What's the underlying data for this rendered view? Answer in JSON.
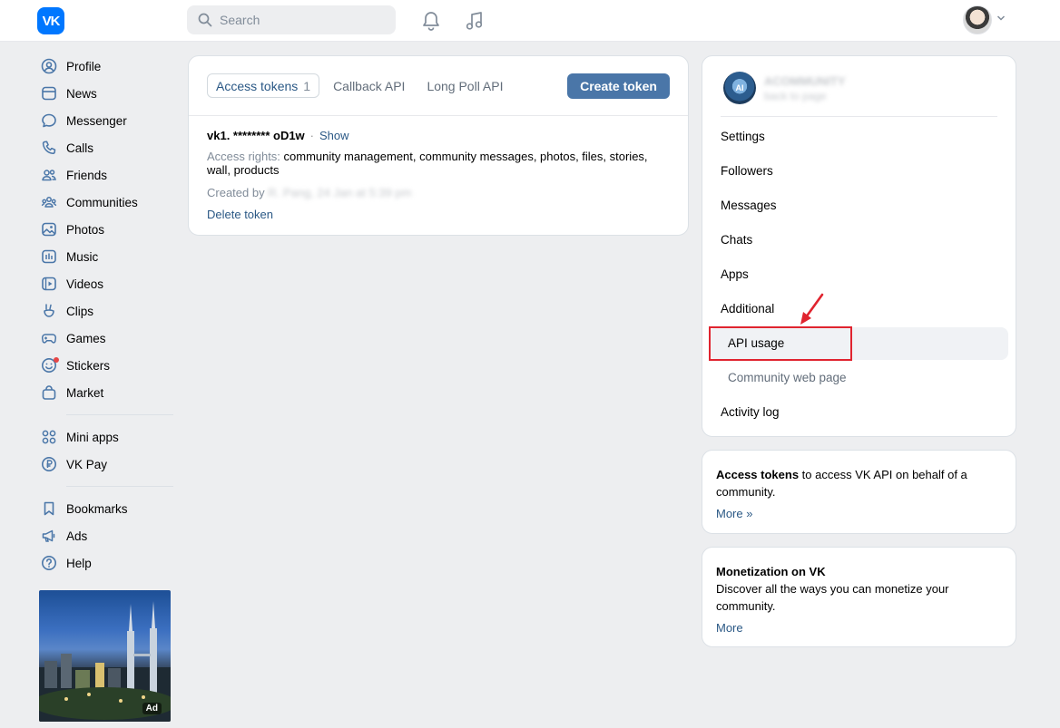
{
  "header": {
    "logo_text": "VK",
    "search_placeholder": "Search",
    "icons": [
      "bell-icon",
      "music-icon",
      "chevron-down-icon"
    ]
  },
  "nav": {
    "items": [
      {
        "label": "Profile",
        "icon": "profile-icon"
      },
      {
        "label": "News",
        "icon": "news-icon"
      },
      {
        "label": "Messenger",
        "icon": "messenger-icon"
      },
      {
        "label": "Calls",
        "icon": "phone-icon"
      },
      {
        "label": "Friends",
        "icon": "friends-icon"
      },
      {
        "label": "Communities",
        "icon": "communities-icon"
      },
      {
        "label": "Photos",
        "icon": "photos-icon"
      },
      {
        "label": "Music",
        "icon": "music-icon"
      },
      {
        "label": "Videos",
        "icon": "videos-icon"
      },
      {
        "label": "Clips",
        "icon": "clips-icon"
      },
      {
        "label": "Games",
        "icon": "games-icon"
      },
      {
        "label": "Stickers",
        "icon": "stickers-icon"
      },
      {
        "label": "Market",
        "icon": "market-icon"
      }
    ],
    "items2": [
      {
        "label": "Mini apps",
        "icon": "mini-apps-icon"
      },
      {
        "label": "VK Pay",
        "icon": "vk-pay-icon"
      }
    ],
    "items3": [
      {
        "label": "Bookmarks",
        "icon": "bookmark-icon"
      },
      {
        "label": "Ads",
        "icon": "megaphone-icon"
      },
      {
        "label": "Help",
        "icon": "help-icon"
      }
    ],
    "ad_badge": "Ad"
  },
  "center": {
    "tabs": [
      {
        "label": "Access tokens",
        "count": "1"
      },
      {
        "label": "Callback API"
      },
      {
        "label": "Long Poll API"
      }
    ],
    "create_button": "Create token",
    "token": {
      "value": "vk1. ******** oD1w",
      "separator": "·",
      "show": "Show",
      "rights_label": "Access rights:",
      "rights_value": "community management, community messages, photos, files, stories, wall, products",
      "created_label": "Created by",
      "created_value": "R. Pang, 24 Jan at 5:39 pm",
      "delete": "Delete token"
    }
  },
  "right_menu": {
    "community_name": "ACOMMUNITY",
    "community_sub": "back to page",
    "avatar_text": "AI",
    "items": {
      "settings": "Settings",
      "followers": "Followers",
      "messages": "Messages",
      "chats": "Chats",
      "apps": "Apps",
      "additional": "Additional",
      "api_usage": "API usage",
      "community_web_page": "Community web page",
      "activity_log": "Activity log"
    }
  },
  "info_tokens": {
    "bold": "Access tokens",
    "text": " to access VK API on behalf of a community.",
    "more": "More »"
  },
  "info_monetization": {
    "title": "Monetization on VK",
    "text": "Discover all the ways you can monetize your community.",
    "more": "More"
  },
  "colors": {
    "accent": "#4a76a8",
    "link": "#2a5885",
    "highlight": "#e0242f",
    "logo": "#0077ff"
  }
}
